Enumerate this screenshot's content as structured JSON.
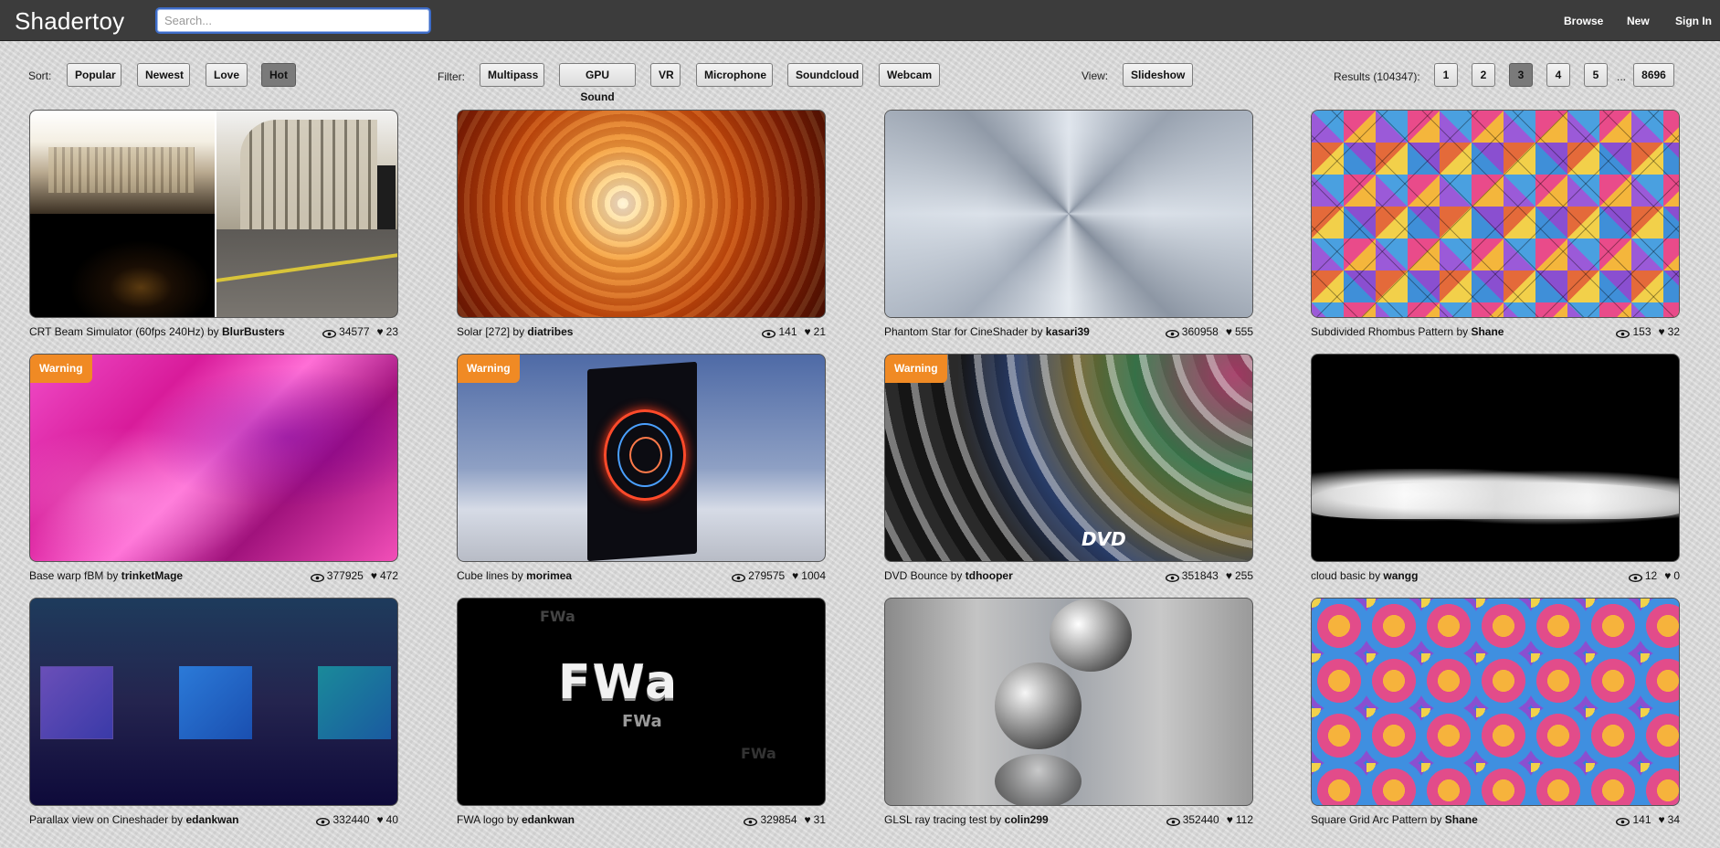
{
  "header": {
    "logo": "Shadertoy",
    "search_placeholder": "Search...",
    "nav": [
      "Browse",
      "New",
      "Sign In"
    ]
  },
  "sort": {
    "label": "Sort:",
    "options": [
      "Popular",
      "Newest",
      "Love",
      "Hot"
    ],
    "active": "Hot"
  },
  "filter": {
    "label": "Filter:",
    "options": [
      "Multipass",
      "GPU Sound",
      "VR",
      "Microphone",
      "Soundcloud",
      "Webcam"
    ]
  },
  "view": {
    "label": "View:",
    "option": "Slideshow"
  },
  "results": {
    "label": "Results (104347):",
    "pages": [
      "1",
      "2",
      "3",
      "4",
      "5"
    ],
    "ellipsis": "...",
    "last_page": "8696",
    "current_page": "3"
  },
  "shaders": [
    {
      "title": "CRT Beam Simulator (60fps 240Hz)",
      "by": "by",
      "author": "BlurBusters",
      "views": "34577",
      "likes": "23",
      "warning": ""
    },
    {
      "title": "Solar [272]",
      "by": "by",
      "author": "diatribes",
      "views": "141",
      "likes": "21",
      "warning": ""
    },
    {
      "title": "Phantom Star for CineShader",
      "by": "by",
      "author": "kasari39",
      "views": "360958",
      "likes": "555",
      "warning": ""
    },
    {
      "title": "Subdivided Rhombus Pattern",
      "by": "by",
      "author": "Shane",
      "views": "153",
      "likes": "32",
      "warning": ""
    },
    {
      "title": "Base warp fBM",
      "by": "by",
      "author": "trinketMage",
      "views": "377925",
      "likes": "472",
      "warning": "Warning"
    },
    {
      "title": "Cube lines",
      "by": "by",
      "author": "morimea",
      "views": "279575",
      "likes": "1004",
      "warning": "Warning"
    },
    {
      "title": "DVD Bounce",
      "by": "by",
      "author": "tdhooper",
      "views": "351843",
      "likes": "255",
      "warning": "Warning"
    },
    {
      "title": "cloud basic",
      "by": "by",
      "author": "wangg",
      "views": "12",
      "likes": "0",
      "warning": ""
    },
    {
      "title": "Parallax view on Cineshader",
      "by": "by",
      "author": "edankwan",
      "views": "332440",
      "likes": "40",
      "warning": ""
    },
    {
      "title": "FWA logo",
      "by": "by",
      "author": "edankwan",
      "views": "329854",
      "likes": "31",
      "warning": ""
    },
    {
      "title": "GLSL ray tracing test",
      "by": "by",
      "author": "colin299",
      "views": "352440",
      "likes": "112",
      "warning": ""
    },
    {
      "title": "Square Grid Arc Pattern",
      "by": "by",
      "author": "Shane",
      "views": "141",
      "likes": "34",
      "warning": ""
    }
  ],
  "thumb_text": {
    "dvd": "DVD",
    "fwa": "FWa"
  },
  "colors": {
    "header_bg": "#3c3c3c",
    "warning": "#f08a24",
    "active_button": "#7a7a7a"
  }
}
